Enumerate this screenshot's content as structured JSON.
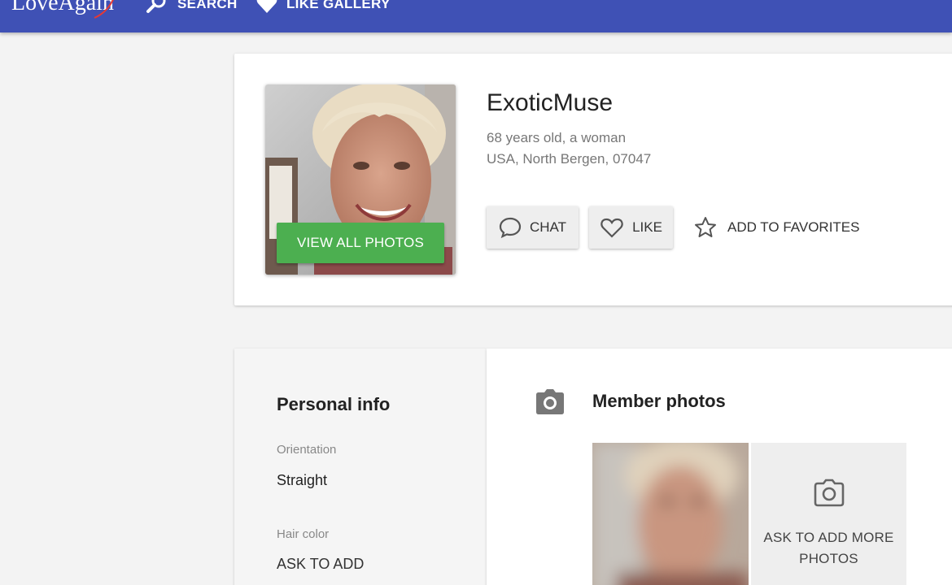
{
  "nav": {
    "logo_text": "LoveAgain",
    "search_label": "SEARCH",
    "like_gallery_label": "LIKE GALLERY"
  },
  "profile": {
    "username": "ExoticMuse",
    "age_gender": "68 years old, a woman",
    "location": "USA, North Bergen, 07047",
    "view_photos_label": "VIEW ALL PHOTOS",
    "chat_label": "CHAT",
    "like_label": "LIKE",
    "favorites_label": "ADD TO FAVORITES"
  },
  "personal_info": {
    "title": "Personal info",
    "fields": [
      {
        "label": "Orientation",
        "value": "Straight"
      },
      {
        "label": "Hair color",
        "value": "ASK TO ADD"
      }
    ]
  },
  "member_photos": {
    "title": "Member photos",
    "ask_more_label": "ASK TO ADD MORE PHOTOS"
  },
  "colors": {
    "nav_bg": "#3f51b5",
    "primary_green": "#4caf50",
    "page_bg": "#f3f3f3"
  },
  "icons": {
    "search": "search-icon",
    "like_gallery": "heart-icon",
    "chat": "chat-bubble-icon",
    "like": "heart-outline-icon",
    "favorites": "star-outline-icon",
    "photos": "camera-icon"
  }
}
